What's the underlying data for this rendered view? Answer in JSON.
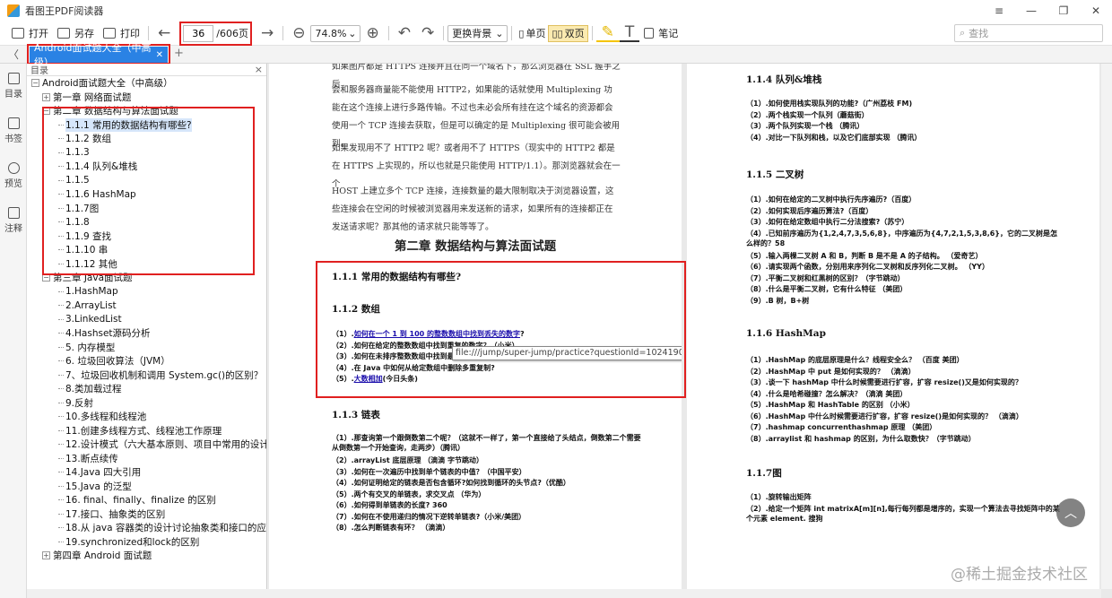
{
  "app": {
    "title": "看图王PDF阅读器",
    "window_controls": [
      "≡",
      "—",
      "❐",
      "✕"
    ]
  },
  "toolbar": {
    "open_label": "打开",
    "save_as_label": "另存",
    "print_label": "打印",
    "prev_page": "←",
    "current_page": "36",
    "page_total": "/606页",
    "next_page": "→",
    "zoom_out": "⊖",
    "zoom_value": "74.8%",
    "zoom_in": "⊕",
    "undo": "↶",
    "redo": "↷",
    "background_label": "更换背景",
    "single_page_label": "单页",
    "double_page_label": "双页",
    "highlight": "✎",
    "text_tool": "T",
    "notes_label": "笔记",
    "search_placeholder": "查找"
  },
  "tabs": {
    "left_arrow": "〈",
    "active": "Android面试题大全（中高级）",
    "close": "✕",
    "add": "+"
  },
  "rail": [
    {
      "icon": "toc-icon",
      "label": "目录"
    },
    {
      "icon": "bookmark-icon",
      "label": "书签"
    },
    {
      "icon": "eye-icon",
      "label": "预览"
    },
    {
      "icon": "comment-icon",
      "label": "注释"
    }
  ],
  "toc": {
    "header": "目录",
    "close": "×",
    "items": [
      {
        "text": "Android面试题大全（中高级）",
        "level": 0,
        "toggle": "−"
      },
      {
        "text": "第一章 网络面试题",
        "level": 1,
        "toggle": "+"
      },
      {
        "text": "第二章 数据结构与算法面试题",
        "level": 1,
        "toggle": "−"
      },
      {
        "text": "1.1.1 常用的数据结构有哪些?",
        "level": 2,
        "selected": true
      },
      {
        "text": "1.1.2 数组",
        "level": 2
      },
      {
        "text": "1.1.3",
        "level": 2
      },
      {
        "text": "1.1.4 队列&堆栈",
        "level": 2
      },
      {
        "text": "1.1.5",
        "level": 2
      },
      {
        "text": "1.1.6 HashMap",
        "level": 2
      },
      {
        "text": "1.1.7图",
        "level": 2
      },
      {
        "text": "1.1.8",
        "level": 2
      },
      {
        "text": "1.1.9 查找",
        "level": 2
      },
      {
        "text": "1.1.10 串",
        "level": 2
      },
      {
        "text": "1.1.12 其他",
        "level": 2
      },
      {
        "text": "第三章 Java面试题",
        "level": 1,
        "toggle": "−"
      },
      {
        "text": "1.HashMap",
        "level": 2
      },
      {
        "text": "2.ArrayList",
        "level": 2
      },
      {
        "text": "3.LinkedList",
        "level": 2
      },
      {
        "text": "4.Hashset源码分析",
        "level": 2
      },
      {
        "text": "5. 内存模型",
        "level": 2
      },
      {
        "text": "6. 垃圾回收算法（JVM）",
        "level": 2
      },
      {
        "text": "7、垃圾回收机制和调用 System.gc()的区别？",
        "level": 2
      },
      {
        "text": "8.类加载过程",
        "level": 2
      },
      {
        "text": "9.反射",
        "level": 2
      },
      {
        "text": "10.多线程和线程池",
        "level": 2
      },
      {
        "text": "11.创建多线程方式、线程池工作原理",
        "level": 2
      },
      {
        "text": "12.设计模式（六大基本原则、项目中常用的设计模式、",
        "level": 2
      },
      {
        "text": "13.断点续传",
        "level": 2
      },
      {
        "text": "14.Java 四大引用",
        "level": 2
      },
      {
        "text": "15.Java 的泛型",
        "level": 2
      },
      {
        "text": "16. final、finally、finalize 的区别",
        "level": 2
      },
      {
        "text": "17.接口、抽象类的区别",
        "level": 2
      },
      {
        "text": "18.从 java 容器类的设计讨论抽象类和接口的应用",
        "level": 2
      },
      {
        "text": "19.synchronized和lock的区别",
        "level": 2
      },
      {
        "text": "第四章 Android 面试题",
        "level": 1,
        "toggle": "+"
      }
    ]
  },
  "left_page": {
    "paras": [
      "如果图片都是 HTTPS 连接并且在同一个域名下，那么浏览器在 SSL 握手之后",
      "会和服务器商量能不能使用 HTTP2，如果能的话就使用 Multiplexing 功能在这个连接上进行多路传输。不过也未必会所有挂在这个域名的资源都会使用一个 TCP 连接去获取，但是可以确定的是 Multiplexing 很可能会被用到。",
      "如果发现用不了 HTTP2 呢？或者用不了 HTTPS（现实中的 HTTP2 都是在 HTTPS 上实现的，所以也就是只能使用 HTTP/1.1）。那浏览器就会在一个",
      "HOST 上建立多个 TCP 连接，连接数量的最大限制取决于浏览器设置，这些连接会在空闲的时候被浏览器用来发送新的请求，如果所有的连接都正在发送请求呢？那其他的请求就只能等等了。"
    ],
    "chapter_title": "第二章 数据结构与算法面试题",
    "s111": "1.1.1 常用的数据结构有哪些?",
    "s112": "1.1.2 数组",
    "s112_q": [
      {
        "num": "（1）.",
        "link": "如何在一个 1 到 100 的整数数组中找到丢失的数字",
        "rest": "?"
      },
      {
        "num": "（2）.",
        "link": "",
        "rest": "如何在给定的整数数组中找到重复的数字？（小米）"
      },
      {
        "num": "（3）.",
        "link": "",
        "rest": "如何在未排序整数数组中找到最大值和最小值？（字节跳动）"
      },
      {
        "num": "（4）.",
        "link": "",
        "rest": "在 Java 中如何从给定数组中删除多重复制?"
      },
      {
        "num": "（5）.",
        "link": "大数相加",
        "rest": "(今日头条)"
      }
    ],
    "tooltip": "file:///jump/super-jump/practice?questionId=1024190",
    "s113": "1.1.3 链表",
    "s113_q": [
      "（1）.那查询第一个跟倒数第二个呢？（这就不一样了，第一个直接给了头结点，倒数第二个需要从倒数第一个开始查询，走两步）（腾讯）",
      "（2）.arrayList 底层原理 （滴滴 字节跳动）",
      "（3）.如何在一次遍历中找到单个链表的中值？（中国平安）",
      "（4）.如何证明给定的链表是否包含循环?如何找到循环的头节点?（优酷）",
      "（5）.两个有交叉的单链表，求交叉点 （华为）",
      "（6）.如何得到单链表的长度? 360",
      "（7）.如何在不使用递归的情况下逆转单链表?（小米/美团）",
      "（8）.怎么判断链表有环？ （滴滴）"
    ]
  },
  "right_page": {
    "s114": "1.1.4 队列&堆栈",
    "s114_q": [
      "（1）.如何使用栈实现队列的功能?（广州荔枝 FM)",
      "（2）.两个栈实现一个队列（蘑菇街）",
      "（3）.两个队列实现一个栈 （腾讯）",
      "（4）.对比一下队列和栈，以及它们底部实现 （腾讯）"
    ],
    "s115": "1.1.5 二叉树",
    "s115_q": [
      "（1）.如何在给定的二叉树中执行先序遍历?（百度）",
      "（2）.如何实现后序遍历算法?（百度）",
      "（3）.如何在给定数组中执行二分法搜索?（苏宁）",
      "（4）.已知前序遍历为{1,2,4,7,3,5,6,8}，中序遍历为{4,7,2,1,5,3,8,6}，它的二叉树是怎么样的？58",
      "（5）.输入两棵二叉树 A 和 B，判断 B 是不是 A 的子结构。 （爱奇艺）",
      "（6）.请实现两个函数，分别用来序列化二叉树和反序列化二叉树。 （YY）",
      "（7）.平衡二叉树和红黑树的区别？（字节跳动）",
      "（8）.什么是平衡二叉树，它有什么特征 （美团）",
      "（9）.B 树，B+树"
    ],
    "s116": "1.1.6 HashMap",
    "s116_q": [
      "（1）.HashMap 的底层原理是什么？线程安全么？ （百度 美团）",
      "（2）.HashMap 中 put 是如何实现的？ （滴滴）",
      "（3）.谈一下 hashMap 中什么时候需要进行扩容，扩容 resize()又是如何实现的？",
      "（4）.什么是哈希碰撞？怎么解决？（滴滴 美团）",
      "（5）.HashMap 和 HashTable 的区别 （小米）",
      "（6）.HashMap 中什么时候需要进行扩容，扩容 resize()是如何实现的？ （滴滴）",
      "（7）.hashmap concurrenthashmap 原理 （美团）",
      "（8）.arraylist 和 hashmap 的区别，为什么取数快？（字节跳动）"
    ],
    "s117": "1.1.7图",
    "s117_q": [
      "（1）.旋转输出矩阵",
      "（2）.给定一个矩阵 int matrixA[m][n],每行每列都是增序的，实现一个算法去寻找矩阵中的某个元素 element. 搜狗"
    ]
  },
  "overlay": {
    "up_arrow": "︿",
    "watermark": "@稀土掘金技术社区"
  }
}
